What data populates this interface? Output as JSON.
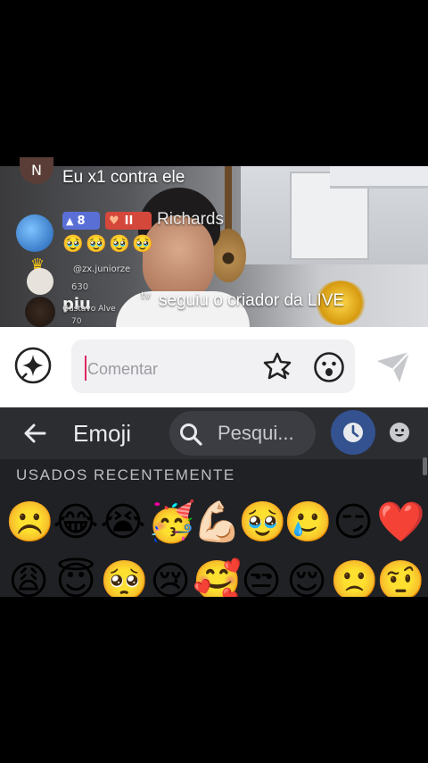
{
  "live": {
    "chat": [
      {
        "avatar_initial": "N",
        "text": "Eu x1 contra ele"
      },
      {
        "level": "8",
        "badge": "II",
        "name": "Richards",
        "emojis": [
          "🥹",
          "🥹",
          "🥹",
          "🥹"
        ]
      },
      {
        "username": "@zx.juniorze",
        "subtext": "630"
      },
      {
        "username": "piu",
        "subtext": "Gustavo Alve",
        "count": "70"
      }
    ],
    "follow_message": "seguiu o criador da LIVE",
    "follow_prefix": "tv"
  },
  "comment_bar": {
    "placeholder": "Comentar"
  },
  "emoji_keyboard": {
    "title": "Emoji",
    "search_placeholder": "Pesqui...",
    "section_label": "USADOS RECENTEMENTE",
    "row1": [
      "☹️",
      "😂",
      "😭",
      "🥳",
      "💪🏻",
      "🥹",
      "🥲",
      "😏",
      "❤️"
    ],
    "row2": [
      "😩",
      "😇",
      "🥺",
      "😢",
      "🥰",
      "😒",
      "😌",
      "🙁",
      "🤨"
    ]
  },
  "colors": {
    "accent_caret": "#e0245e",
    "recent_tab": "#33528f",
    "keyboard_bg": "#202124",
    "header_bg": "#2c2d31"
  }
}
